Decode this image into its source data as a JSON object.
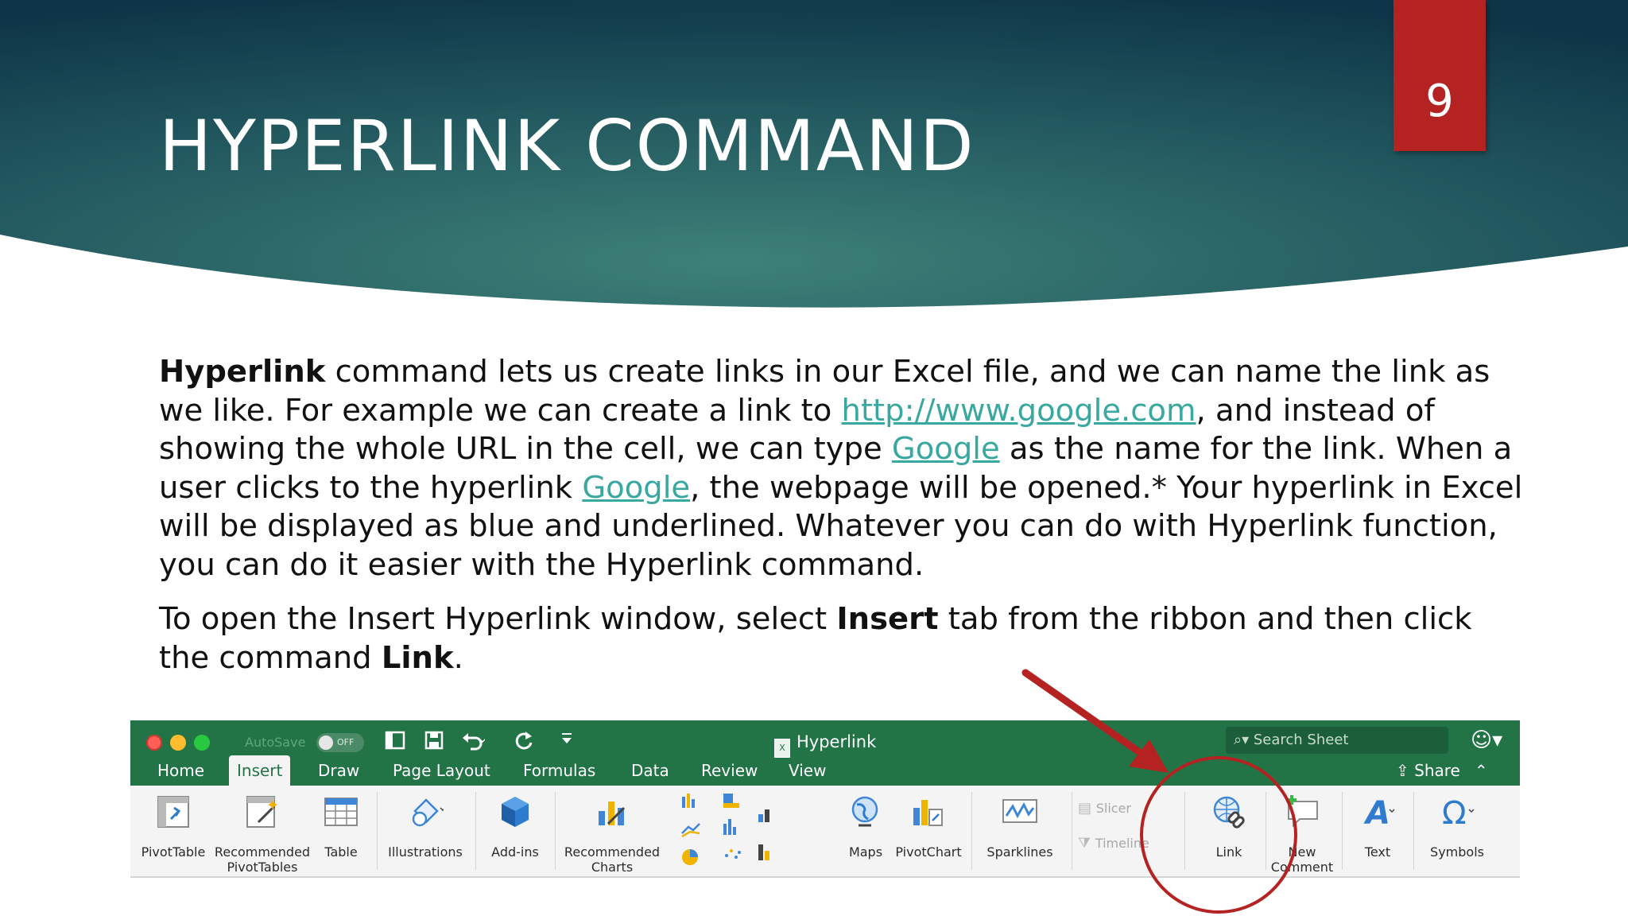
{
  "slide": {
    "title": "HYPERLINK COMMAND",
    "page_number": "9",
    "colors": {
      "banner_dark": "#0e3a4c",
      "banner_light": "#3a7d74",
      "page_tab": "#b52222",
      "link": "#39a8a0"
    }
  },
  "paragraph1": {
    "bold_term": "Hyperlink",
    "text_a": " command lets us create links in our Excel file, and we can name the link as we like. For example we can create a link to ",
    "url": "http://www.google.com",
    "text_b": ", and instead of showing the whole URL in the cell, we can type ",
    "link_name": "Google",
    "text_c": " as the name for the link. When a user clicks to the hyperlink ",
    "link_name2": "Google",
    "text_d": ", the webpage will be opened.* Your hyperlink in Excel will be displayed as blue and underlined. Whatever you can do with Hyperlink function, you can do it easier with the Hyperlink command."
  },
  "paragraph2": {
    "text_a": "To open the Insert Hyperlink window, select ",
    "bold_insert": "Insert",
    "text_b": " tab from the ribbon and then click the command ",
    "bold_link": "Link",
    "text_c": "."
  },
  "excel": {
    "autosave_label": "AutoSave",
    "autosave_state": "OFF",
    "document_title": "Hyperlink",
    "search_placeholder": "Search Sheet",
    "share_label": "Share",
    "tabs": [
      "Home",
      "Insert",
      "Draw",
      "Page Layout",
      "Formulas",
      "Data",
      "Review",
      "View"
    ],
    "active_tab": "Insert",
    "ribbon": {
      "pivottable": "PivotTable",
      "recommended_pivot_line1": "Recommended",
      "recommended_pivot_line2": "PivotTables",
      "table": "Table",
      "illustrations": "Illustrations",
      "addins": "Add-ins",
      "recommended_charts_line1": "Recommended",
      "recommended_charts_line2": "Charts",
      "maps": "Maps",
      "pivotchart": "PivotChart",
      "sparklines": "Sparklines",
      "slicer": "Slicer",
      "timeline": "Timeline",
      "link": "Link",
      "new_comment_line1": "New",
      "new_comment_line2": "Comment",
      "text": "Text",
      "symbols": "Symbols"
    },
    "colors": {
      "titlebar": "#227447",
      "annotation": "#b52222"
    }
  }
}
